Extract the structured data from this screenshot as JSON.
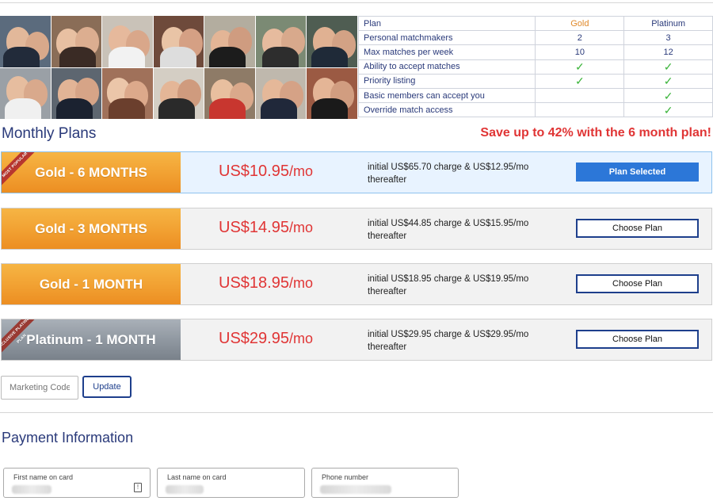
{
  "features": {
    "headers": {
      "plan": "Plan",
      "gold": "Gold",
      "platinum": "Platinum"
    },
    "rows": [
      {
        "label": "Personal matchmakers",
        "gold": "2",
        "platinum": "3"
      },
      {
        "label": "Max matches per week",
        "gold": "10",
        "platinum": "12"
      },
      {
        "label": "Ability to accept matches",
        "gold": "✓",
        "platinum": "✓"
      },
      {
        "label": "Priority listing",
        "gold": "✓",
        "platinum": "✓"
      },
      {
        "label": "Basic members can accept you",
        "gold": "",
        "platinum": "✓"
      },
      {
        "label": "Override match access",
        "gold": "",
        "platinum": "✓"
      }
    ]
  },
  "monthly": {
    "title": "Monthly Plans",
    "save": "Save up to 42% with the 6 month plan!"
  },
  "plans": [
    {
      "name": "Gold - 6 MONTHS",
      "price": "US$10.95",
      "per": "/mo",
      "terms": "initial US$65.70 charge & US$12.95/mo thereafter",
      "button": "Plan Selected",
      "ribbon": "MOST POPULAR"
    },
    {
      "name": "Gold - 3 MONTHS",
      "price": "US$14.95",
      "per": "/mo",
      "terms": "initial US$44.85 charge & US$15.95/mo thereafter",
      "button": "Choose Plan"
    },
    {
      "name": "Gold - 1 MONTH",
      "price": "US$18.95",
      "per": "/mo",
      "terms": "initial US$18.95 charge & US$19.95/mo thereafter",
      "button": "Choose Plan"
    },
    {
      "name": "Platinum - 1 MONTH",
      "price": "US$29.95",
      "per": "/mo",
      "terms": "initial US$29.95 charge & US$29.95/mo thereafter",
      "button": "Choose Plan",
      "ribbon": "EXCLUSIVE PLATINUM PLAN"
    }
  ],
  "marketing": {
    "placeholder": "Marketing Code",
    "update": "Update"
  },
  "payment": {
    "title": "Payment Information",
    "first_name_label": "First name on card",
    "last_name_label": "Last name on card",
    "phone_label": "Phone number"
  },
  "colors": {
    "gold": "#f2a233",
    "platinum": "#8e969f",
    "price": "#e03535",
    "accent": "#2c77d8",
    "navy": "#2a3a7a",
    "check": "#3bb43a"
  }
}
